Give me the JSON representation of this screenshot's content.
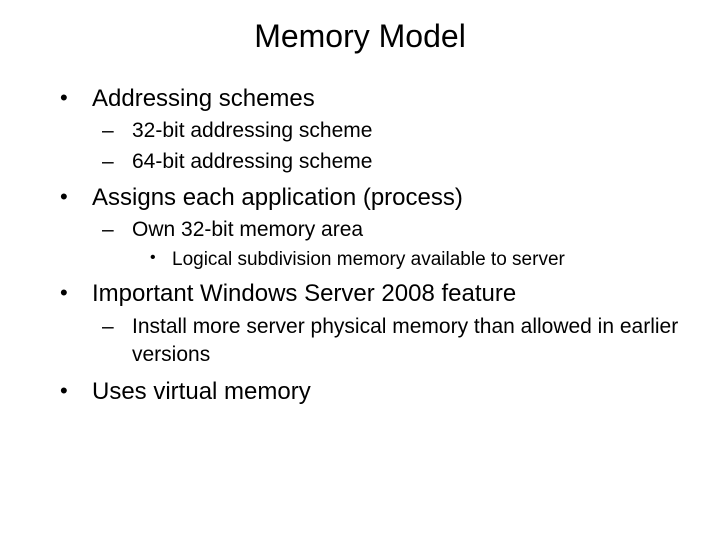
{
  "title": "Memory Model",
  "b1": "Addressing schemes",
  "b1_1": "32-bit addressing scheme",
  "b1_2": "64-bit addressing scheme",
  "b2": "Assigns each application (process)",
  "b2_1": "Own 32-bit memory area",
  "b2_1_1": "Logical subdivision memory available to server",
  "b3": "Important Windows Server 2008 feature",
  "b3_1": "Install more server physical memory than allowed in earlier versions",
  "b4": "Uses virtual memory"
}
